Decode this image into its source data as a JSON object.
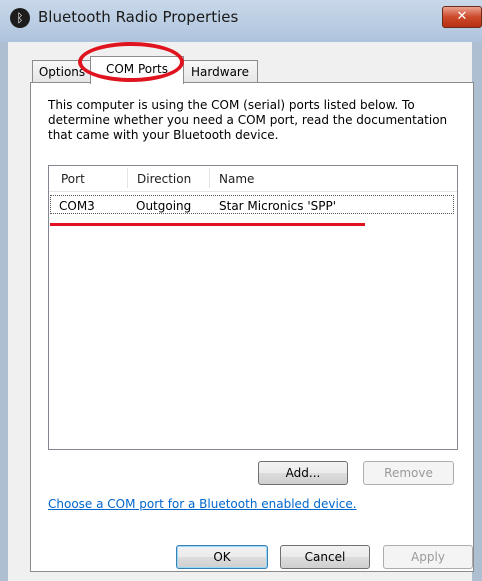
{
  "window": {
    "title": "Bluetooth Radio Properties",
    "icon": "bluetooth-icon",
    "close_glyph": "✕"
  },
  "tabs": [
    {
      "label": "Options",
      "active": false
    },
    {
      "label": "COM Ports",
      "active": true
    },
    {
      "label": "Hardware",
      "active": false
    }
  ],
  "description": "This computer is using the COM (serial) ports listed below. To determine whether you need a COM port, read the documentation that came with your Bluetooth device.",
  "list": {
    "columns": [
      "Port",
      "Direction",
      "Name"
    ],
    "rows": [
      {
        "port": "COM3",
        "direction": "Outgoing",
        "name": "Star Micronics 'SPP'"
      }
    ]
  },
  "buttons": {
    "add": "Add...",
    "remove": "Remove",
    "ok": "OK",
    "cancel": "Cancel",
    "apply": "Apply"
  },
  "link": "Choose a COM port for a Bluetooth enabled device.",
  "colors": {
    "annotation": "#e0141e",
    "link": "#0066cc"
  }
}
